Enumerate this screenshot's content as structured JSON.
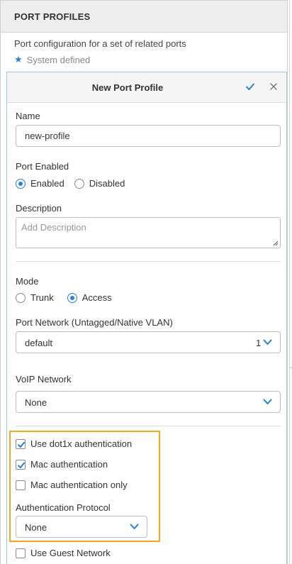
{
  "header": {
    "title": "PORT PROFILES"
  },
  "intro": {
    "subtitle": "Port configuration for a set of related ports",
    "system_defined": "System defined"
  },
  "panel": {
    "title": "New Port Profile",
    "name": {
      "label": "Name",
      "value": "new-profile"
    },
    "port_enabled": {
      "label": "Port Enabled",
      "options": [
        {
          "label": "Enabled",
          "selected": true
        },
        {
          "label": "Disabled",
          "selected": false
        }
      ]
    },
    "description": {
      "label": "Description",
      "placeholder": "Add Description",
      "value": ""
    },
    "mode": {
      "label": "Mode",
      "options": [
        {
          "label": "Trunk",
          "selected": false
        },
        {
          "label": "Access",
          "selected": true
        }
      ]
    },
    "port_network": {
      "label": "Port Network (Untagged/Native VLAN)",
      "value": "default",
      "count": "1"
    },
    "voip_network": {
      "label": "VoIP Network",
      "value": "None"
    },
    "auth": {
      "use_dot1x": {
        "label": "Use dot1x authentication",
        "checked": true
      },
      "mac_auth": {
        "label": "Mac authentication",
        "checked": true
      },
      "mac_auth_only": {
        "label": "Mac authentication only",
        "checked": false
      },
      "protocol": {
        "label": "Authentication Protocol",
        "value": "None"
      }
    },
    "guest_network": {
      "label": "Use Guest Network",
      "checked": false
    }
  },
  "colors": {
    "accent": "#2a7fd4",
    "highlight": "#f0a81e",
    "panel_border": "#9fc8e8",
    "header_bg": "#eeeeee"
  }
}
